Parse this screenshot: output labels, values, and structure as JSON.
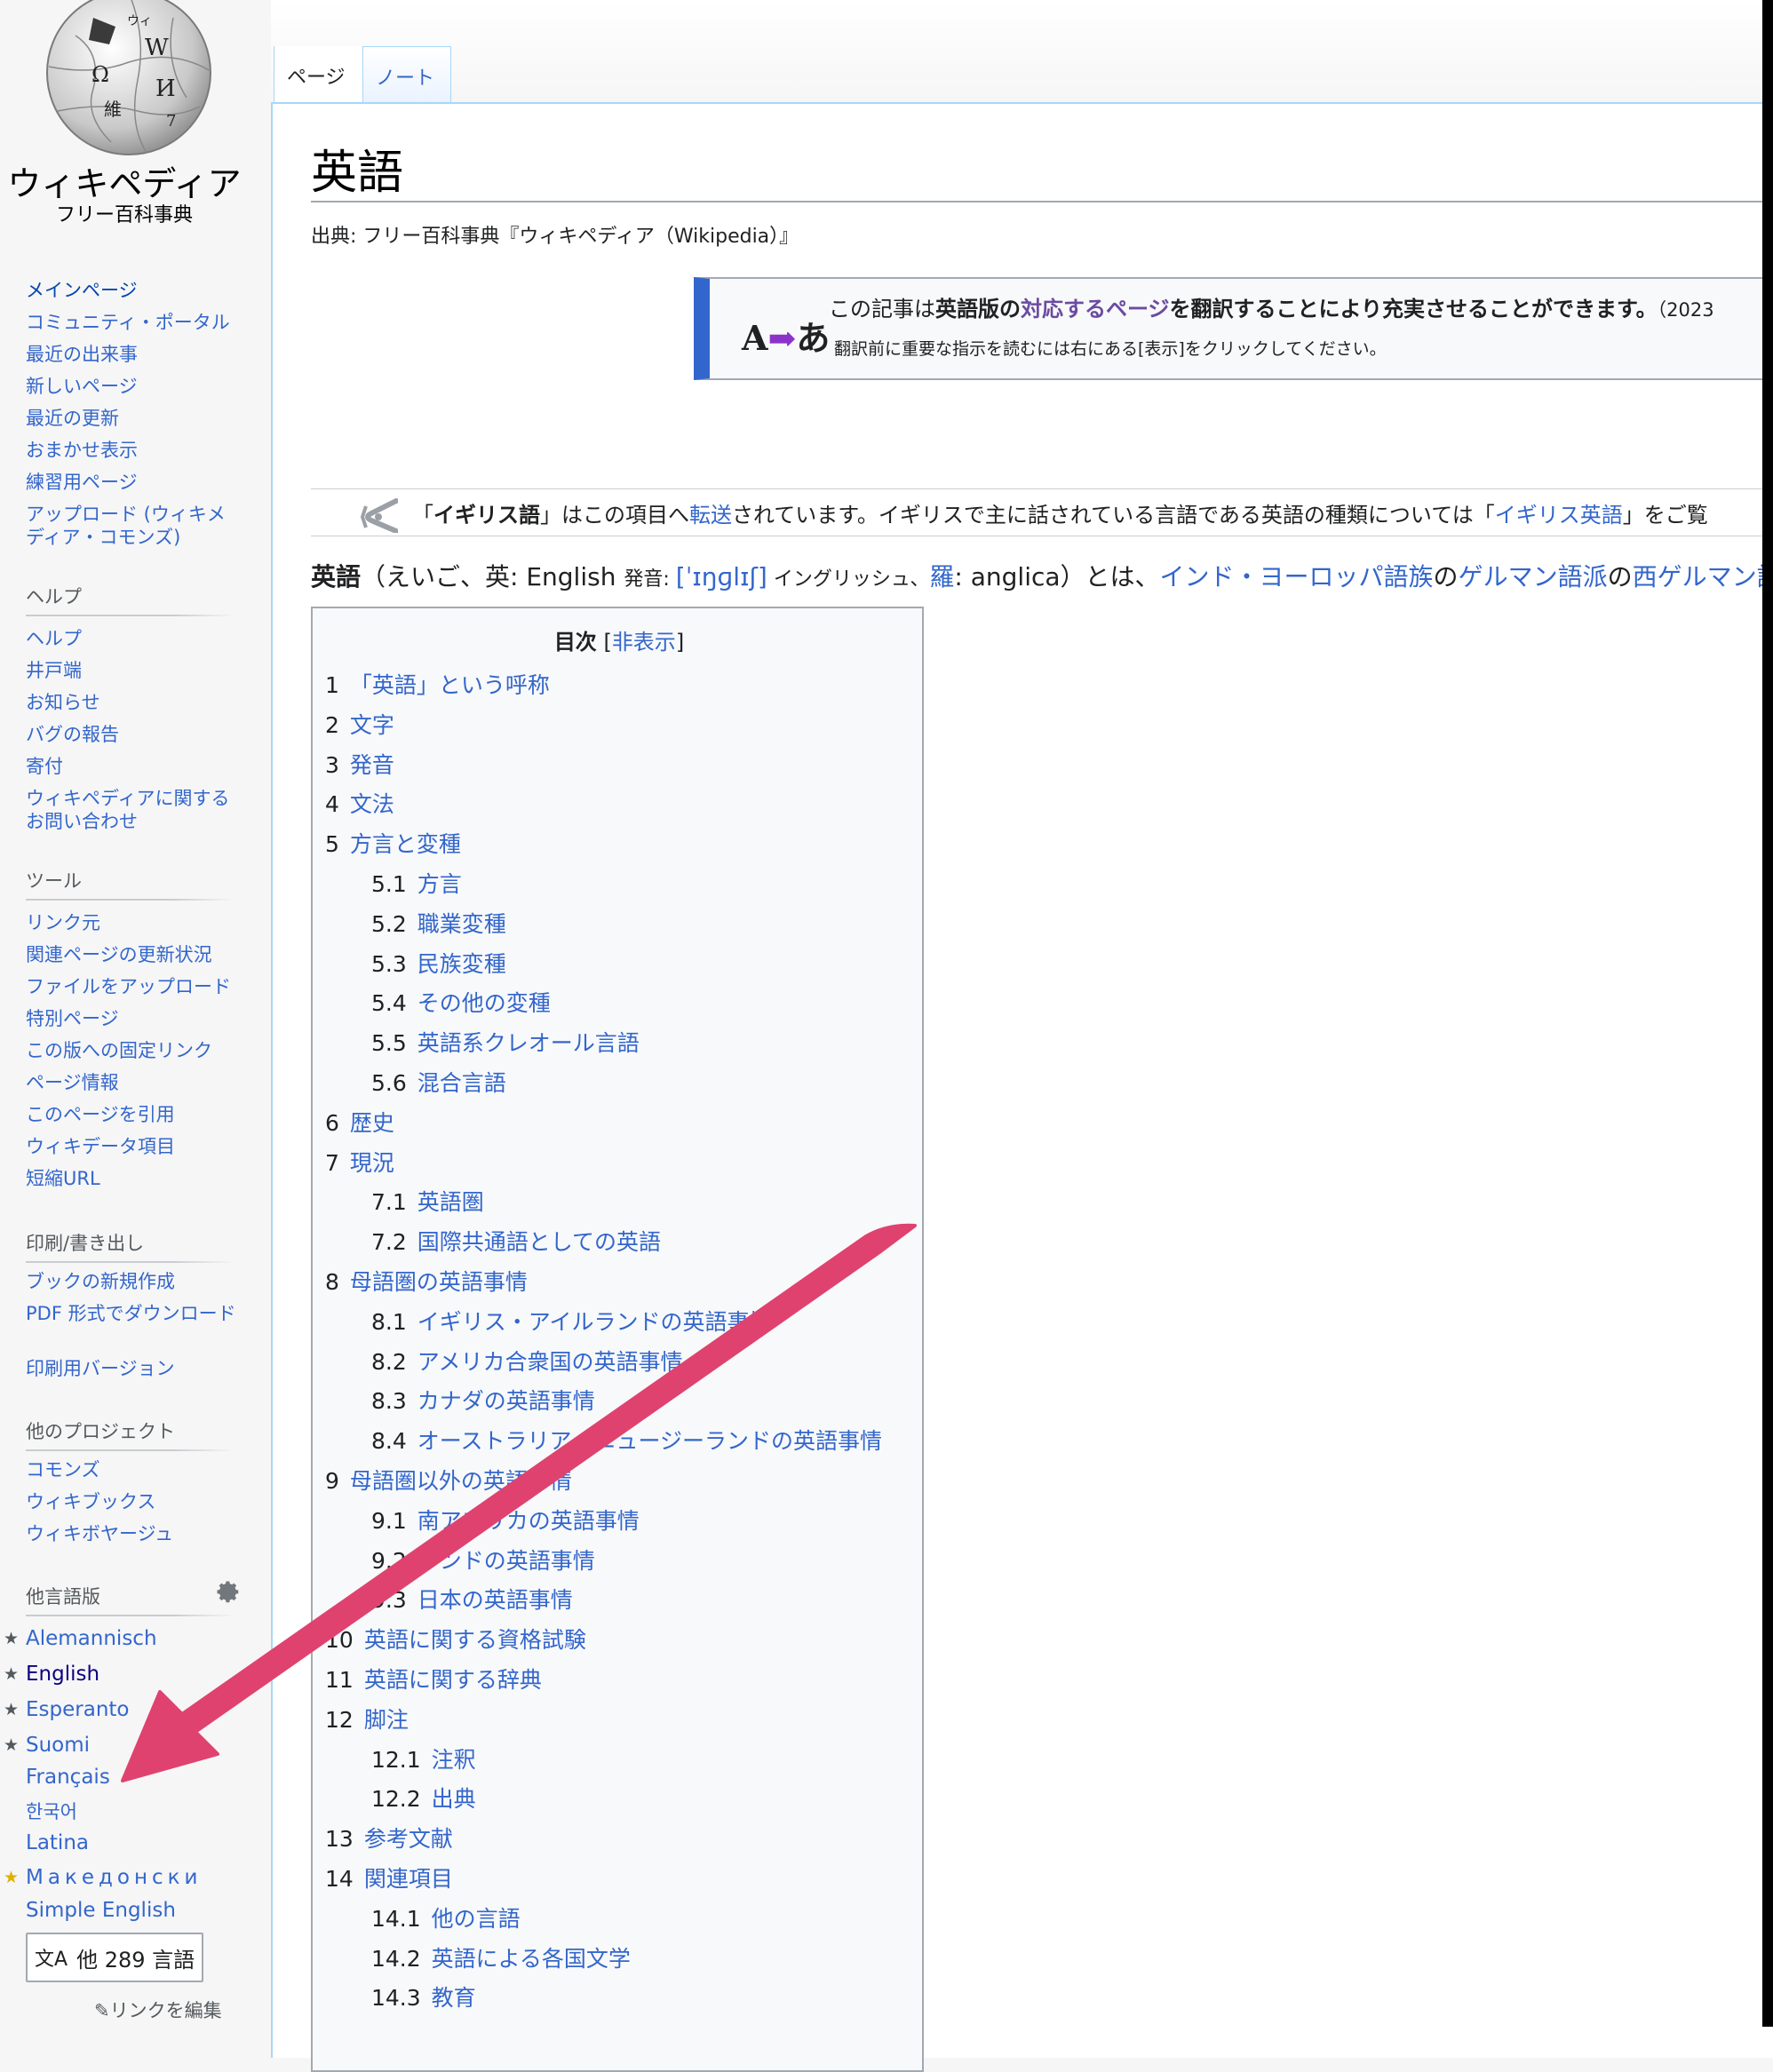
{
  "logo": {
    "wordmark": "ウィキペディア",
    "tagline": "フリー百科事典",
    "globe_glyphs": [
      "W",
      "Ω",
      "И",
      "維",
      "ウィ",
      "7"
    ]
  },
  "navigation": {
    "items": [
      "メインページ",
      "コミュニティ・ポータル",
      "最近の出来事",
      "新しいページ",
      "最近の更新",
      "おまかせ表示",
      "練習用ページ",
      "アップロード (ウィキメディア・コモンズ)"
    ]
  },
  "help": {
    "heading": "ヘルプ",
    "items": [
      "ヘルプ",
      "井戸端",
      "お知らせ",
      "バグの報告",
      "寄付",
      "ウィキペディアに関するお問い合わせ"
    ]
  },
  "tools": {
    "heading": "ツール",
    "items": [
      "リンク元",
      "関連ページの更新状況",
      "ファイルをアップロード",
      "特別ページ",
      "この版への固定リンク",
      "ページ情報",
      "このページを引用",
      "ウィキデータ項目",
      "短縮URL"
    ]
  },
  "print": {
    "heading": "印刷/書き出し",
    "items": [
      "ブックの新規作成",
      "PDF 形式でダウンロード",
      "印刷用バージョン"
    ]
  },
  "projects": {
    "heading": "他のプロジェクト",
    "items": [
      "コモンズ",
      "ウィキブックス",
      "ウィキボヤージュ"
    ]
  },
  "languages": {
    "heading": "他言語版",
    "items": [
      {
        "label": "Alemannisch",
        "star": "grey"
      },
      {
        "label": "English",
        "star": "grey"
      },
      {
        "label": "Esperanto",
        "star": "grey"
      },
      {
        "label": "Suomi",
        "star": "grey"
      },
      {
        "label": "Français",
        "star": ""
      },
      {
        "label": "한국어",
        "star": ""
      },
      {
        "label": "Latina",
        "star": ""
      },
      {
        "label": "Македонски",
        "star": "gold"
      },
      {
        "label": "Simple English",
        "star": ""
      }
    ],
    "more_button": "他 289 言語",
    "edit_links": "リンクを編集"
  },
  "tabs": {
    "page": "ページ",
    "talk": "ノート"
  },
  "article": {
    "title": "英語",
    "site_sub": "出典: フリー百科事典『ウィキペディア（Wikipedia）』"
  },
  "ambox": {
    "icon_a": "A",
    "icon_arrow": "➡",
    "icon_b": "あ",
    "t1": "この記事は",
    "t2": "英語版の",
    "t3": "対応するページ",
    "t4": "を翻訳することにより充実させることができます。",
    "date": "（2023",
    "sub": "翻訳前に重要な指示を読むには右にある[表示]をクリックしてください。"
  },
  "hatnote": {
    "p1": "「",
    "p2": "イギリス語",
    "p3": "」はこの項目へ",
    "p4": "転送",
    "p5": "されています。イギリスで主に話されている言語である英語の種類については「",
    "p6": "イギリス英語",
    "p7": "」をご覧"
  },
  "lead": {
    "l1": "英語",
    "l2": "（えいご、英: English ",
    "l3": "発音: ",
    "l4": "[ˈɪŋɡlɪʃ]",
    "l5": " イングリッシュ、",
    "l6": "羅",
    "l7": ": anglica）とは、",
    "l8": "インド・ヨーロッパ語族",
    "l9": "の",
    "l10": "ゲルマン語派",
    "l11": "の",
    "l12": "西ゲルマン語"
  },
  "toc": {
    "title": "目次",
    "hide_open": " [",
    "hide": "非表示",
    "hide_close": "]",
    "items": [
      {
        "num": "1",
        "text": "「英語」という呼称"
      },
      {
        "num": "2",
        "text": "文字"
      },
      {
        "num": "3",
        "text": "発音"
      },
      {
        "num": "4",
        "text": "文法"
      },
      {
        "num": "5",
        "text": "方言と変種"
      },
      {
        "num": "5.1",
        "text": "方言"
      },
      {
        "num": "5.2",
        "text": "職業変種"
      },
      {
        "num": "5.3",
        "text": "民族変種"
      },
      {
        "num": "5.4",
        "text": "その他の変種"
      },
      {
        "num": "5.5",
        "text": "英語系クレオール言語"
      },
      {
        "num": "5.6",
        "text": "混合言語"
      },
      {
        "num": "6",
        "text": "歴史"
      },
      {
        "num": "7",
        "text": "現況"
      },
      {
        "num": "7.1",
        "text": "英語圏"
      },
      {
        "num": "7.2",
        "text": "国際共通語としての英語"
      },
      {
        "num": "8",
        "text": "母語圏の英語事情"
      },
      {
        "num": "8.1",
        "text": "イギリス・アイルランドの英語事情"
      },
      {
        "num": "8.2",
        "text": "アメリカ合衆国の英語事情"
      },
      {
        "num": "8.3",
        "text": "カナダの英語事情"
      },
      {
        "num": "8.4",
        "text": "オーストラリア・ニュージーランドの英語事情"
      },
      {
        "num": "9",
        "text": "母語圏以外の英語事情"
      },
      {
        "num": "9.1",
        "text": "南アフリカの英語事情"
      },
      {
        "num": "9.2",
        "text": "インドの英語事情"
      },
      {
        "num": "9.3",
        "text": "日本の英語事情"
      },
      {
        "num": "10",
        "text": "英語に関する資格試験"
      },
      {
        "num": "11",
        "text": "英語に関する辞典"
      },
      {
        "num": "12",
        "text": "脚注"
      },
      {
        "num": "12.1",
        "text": "注釈"
      },
      {
        "num": "12.2",
        "text": "出典"
      },
      {
        "num": "13",
        "text": "参考文献"
      },
      {
        "num": "14",
        "text": "関連項目"
      },
      {
        "num": "14.1",
        "text": "他の言語"
      },
      {
        "num": "14.2",
        "text": "英語による各国文学"
      },
      {
        "num": "14.3",
        "text": "教育"
      }
    ]
  },
  "colors": {
    "link": "#3366cc",
    "annotation_arrow": "#e0426f",
    "ambox_bar": "#3366cc"
  }
}
